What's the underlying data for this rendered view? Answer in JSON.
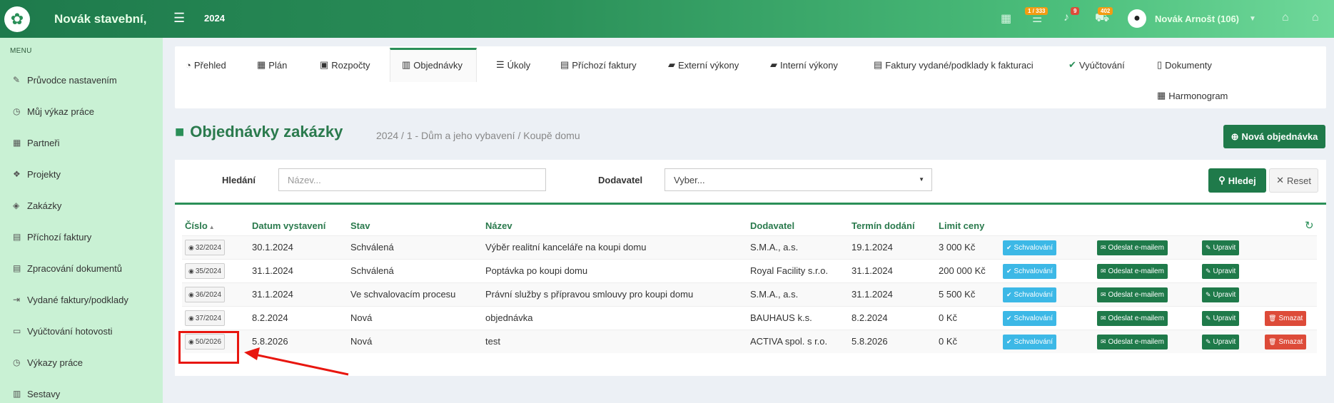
{
  "app": {
    "name": "Novák stavební,",
    "year": "2024"
  },
  "topbar": {
    "badges": {
      "tasks": "1 / 333",
      "notifications": "9",
      "cars": "402"
    },
    "user_name": "Novák Arnošt (106)"
  },
  "sidebar": {
    "menu_label": "MENU",
    "items": [
      {
        "label": "Průvodce nastavením",
        "icon": "pencil-icon"
      },
      {
        "label": "Můj výkaz práce",
        "icon": "clock-icon"
      },
      {
        "label": "Partneři",
        "icon": "building-icon"
      },
      {
        "label": "Projekty",
        "icon": "cubes-icon"
      },
      {
        "label": "Zakázky",
        "icon": "cube-icon"
      },
      {
        "label": "Příchozí faktury",
        "icon": "file-icon"
      },
      {
        "label": "Zpracování dokumentů",
        "icon": "file-edit-icon"
      },
      {
        "label": "Vydané faktury/podklady",
        "icon": "export-icon"
      },
      {
        "label": "Vyúčtování hotovosti",
        "icon": "money-icon"
      },
      {
        "label": "Výkazy práce",
        "icon": "clock-icon"
      },
      {
        "label": "Sestavy",
        "icon": "chart-icon"
      }
    ]
  },
  "tabs": [
    {
      "label": "Přehled"
    },
    {
      "label": "Plán"
    },
    {
      "label": "Rozpočty"
    },
    {
      "label": "Objednávky"
    },
    {
      "label": "Úkoly"
    },
    {
      "label": "Příchozí faktury"
    },
    {
      "label": "Externí výkony"
    },
    {
      "label": "Interní výkony"
    },
    {
      "label": "Faktury vydané/podklady k fakturaci"
    },
    {
      "label": "Vyúčtování"
    },
    {
      "label": "Dokumenty"
    },
    {
      "label": "Harmonogram"
    }
  ],
  "page": {
    "title": "Objednávky zakázky",
    "subtitle": "2024 / 1 - Dům a jeho vybavení / Koupě domu",
    "new_button": "Nová objednávka"
  },
  "search": {
    "label": "Hledání",
    "placeholder": "Název...",
    "supplier_label": "Dodavatel",
    "supplier_value": "Vyber...",
    "search_button": "Hledej",
    "reset_button": "Reset"
  },
  "table": {
    "headers": [
      "Číslo",
      "Datum vystavení",
      "Stav",
      "Název",
      "Dodavatel",
      "Termín dodání",
      "Limit ceny"
    ],
    "actions": {
      "approve": "Schvalování",
      "email": "Odeslat e-mailem",
      "edit": "Upravit",
      "delete": "Smazat"
    },
    "rows": [
      {
        "number": "32/2024",
        "date": "30.1.2024",
        "status": "Schválená",
        "name": "Výběr realitní kanceláře na koupi domu",
        "supplier": "S.M.A., a.s.",
        "deadline": "19.1.2024",
        "limit": "3 000 Kč"
      },
      {
        "number": "35/2024",
        "date": "31.1.2024",
        "status": "Schválená",
        "name": "Poptávka po koupi domu",
        "supplier": "Royal Facility s.r.o.",
        "deadline": "31.1.2024",
        "limit": "200 000 Kč"
      },
      {
        "number": "36/2024",
        "date": "31.1.2024",
        "status": "Ve schvalovacím procesu",
        "name": "Právní služby s přípravou smlouvy pro koupi domu",
        "supplier": "S.M.A., a.s.",
        "deadline": "31.1.2024",
        "limit": "5 500 Kč"
      },
      {
        "number": "37/2024",
        "date": "8.2.2024",
        "status": "Nová",
        "name": "objednávka",
        "supplier": "BAUHAUS k.s.",
        "deadline": "8.2.2024",
        "limit": "0 Kč"
      },
      {
        "number": "50/2026",
        "date": "5.8.2026",
        "status": "Nová",
        "name": "test",
        "supplier": "ACTIVA spol. s r.o.",
        "deadline": "5.8.2026",
        "limit": "0 Kč"
      }
    ]
  }
}
